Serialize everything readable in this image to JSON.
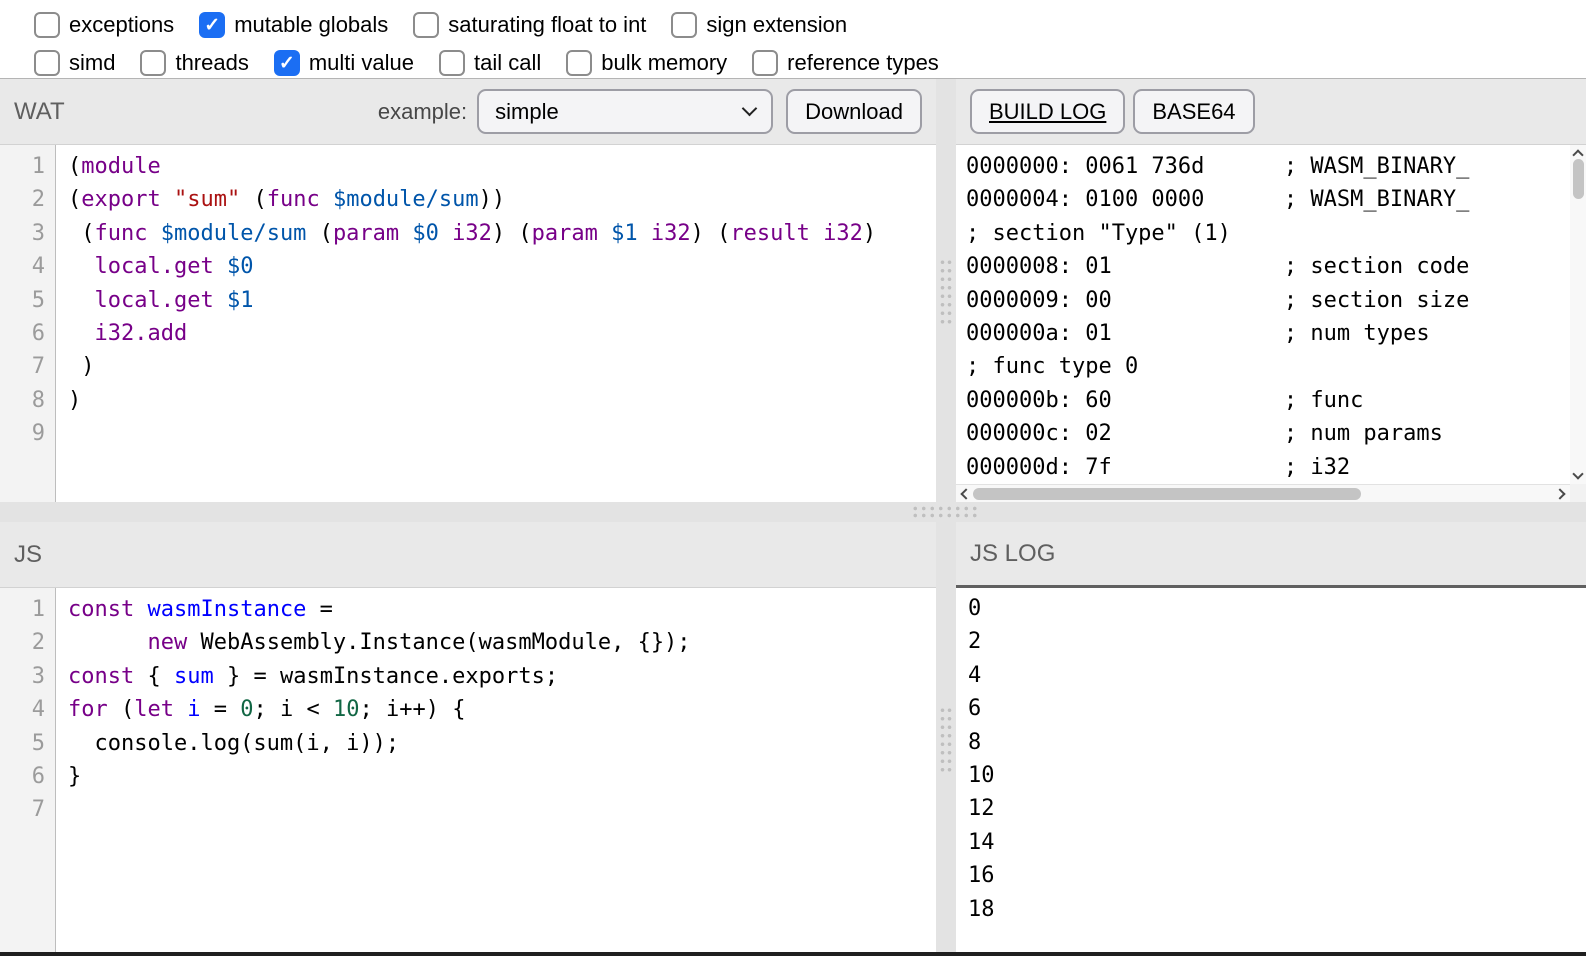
{
  "icons": {
    "checkmark": "✓"
  },
  "features": {
    "row1": [
      {
        "label": "exceptions",
        "checked": false
      },
      {
        "label": "mutable globals",
        "checked": true
      },
      {
        "label": "saturating float to int",
        "checked": false
      },
      {
        "label": "sign extension",
        "checked": false
      }
    ],
    "row2": [
      {
        "label": "simd",
        "checked": false
      },
      {
        "label": "threads",
        "checked": false
      },
      {
        "label": "multi value",
        "checked": true
      },
      {
        "label": "tail call",
        "checked": false
      },
      {
        "label": "bulk memory",
        "checked": false
      },
      {
        "label": "reference types",
        "checked": false
      }
    ]
  },
  "wat": {
    "title": "WAT",
    "example_label": "example:",
    "example_selected": "simple",
    "download_label": "Download",
    "code": [
      [
        [
          "p",
          "("
        ],
        [
          "k",
          "module"
        ]
      ],
      [
        [
          "p",
          "("
        ],
        [
          "k",
          "export"
        ],
        [
          "p",
          " "
        ],
        [
          "s",
          "\"sum\""
        ],
        [
          "p",
          " ("
        ],
        [
          "k",
          "func"
        ],
        [
          "p",
          " "
        ],
        [
          "v",
          "$module/sum"
        ],
        [
          "p",
          "))"
        ]
      ],
      [
        [
          "p",
          " ("
        ],
        [
          "k",
          "func"
        ],
        [
          "p",
          " "
        ],
        [
          "v",
          "$module/sum"
        ],
        [
          "p",
          " ("
        ],
        [
          "k",
          "param"
        ],
        [
          "p",
          " "
        ],
        [
          "v",
          "$0"
        ],
        [
          "p",
          " "
        ],
        [
          "k",
          "i32"
        ],
        [
          "p",
          ") ("
        ],
        [
          "k",
          "param"
        ],
        [
          "p",
          " "
        ],
        [
          "v",
          "$1"
        ],
        [
          "p",
          " "
        ],
        [
          "k",
          "i32"
        ],
        [
          "p",
          ") ("
        ],
        [
          "k",
          "result"
        ],
        [
          "p",
          " "
        ],
        [
          "k",
          "i32"
        ],
        [
          "p",
          ")"
        ]
      ],
      [
        [
          "p",
          "  "
        ],
        [
          "k",
          "local.get"
        ],
        [
          "p",
          " "
        ],
        [
          "v",
          "$0"
        ]
      ],
      [
        [
          "p",
          "  "
        ],
        [
          "k",
          "local.get"
        ],
        [
          "p",
          " "
        ],
        [
          "v",
          "$1"
        ]
      ],
      [
        [
          "p",
          "  "
        ],
        [
          "k",
          "i32.add"
        ]
      ],
      [
        [
          "p",
          " )"
        ]
      ],
      [
        [
          "p",
          ")"
        ]
      ],
      []
    ]
  },
  "build_log": {
    "tabs": [
      {
        "label": "BUILD LOG",
        "active": true
      },
      {
        "label": "BASE64",
        "active": false
      }
    ],
    "lines": [
      "0000000: 0061 736d      ; WASM_BINARY_",
      "0000004: 0100 0000      ; WASM_BINARY_",
      "; section \"Type\" (1)",
      "0000008: 01             ; section code",
      "0000009: 00             ; section size",
      "000000a: 01             ; num types",
      "; func type 0",
      "000000b: 60             ; func",
      "000000c: 02             ; num params",
      "000000d: 7f             ; i32"
    ]
  },
  "js": {
    "title": "JS",
    "code": [
      [
        [
          "k",
          "const"
        ],
        [
          "p",
          " "
        ],
        [
          "d",
          "wasmInstance"
        ],
        [
          "p",
          " ="
        ]
      ],
      [
        [
          "p",
          "      "
        ],
        [
          "k",
          "new"
        ],
        [
          "p",
          " WebAssembly.Instance(wasmModule, {});"
        ]
      ],
      [
        [
          "k",
          "const"
        ],
        [
          "p",
          " { "
        ],
        [
          "d",
          "sum"
        ],
        [
          "p",
          " } = wasmInstance.exports;"
        ]
      ],
      [
        [
          "k",
          "for"
        ],
        [
          "p",
          " ("
        ],
        [
          "k",
          "let"
        ],
        [
          "p",
          " "
        ],
        [
          "d",
          "i"
        ],
        [
          "p",
          " = "
        ],
        [
          "n",
          "0"
        ],
        [
          "p",
          "; i < "
        ],
        [
          "n",
          "10"
        ],
        [
          "p",
          "; i++) {"
        ]
      ],
      [
        [
          "p",
          "  console.log(sum(i, i));"
        ]
      ],
      [
        [
          "p",
          "}"
        ]
      ],
      []
    ]
  },
  "js_log": {
    "title": "JS LOG",
    "lines": [
      "0",
      "2",
      "4",
      "6",
      "8",
      "10",
      "12",
      "14",
      "16",
      "18"
    ]
  }
}
